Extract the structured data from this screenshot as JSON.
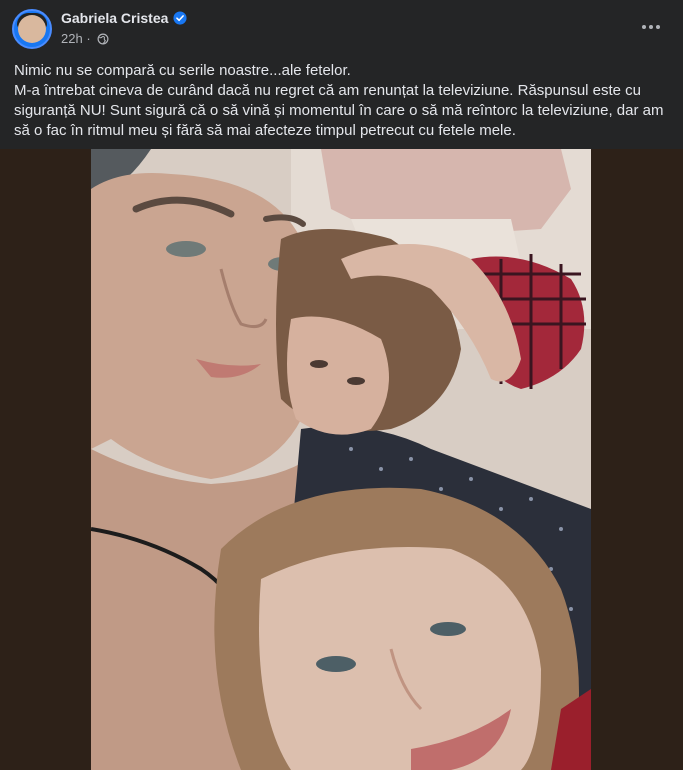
{
  "post": {
    "author": "Gabriela Cristea",
    "time": "22h",
    "privacy_icon": "globe-icon",
    "verified_icon": "verified-badge-icon",
    "more_icon": "more-options-icon",
    "text_lines": [
      "Nimic nu se compară cu serile noastre...ale fetelor.",
      "M-a întrebat cineva de curând dacă nu regret că am renunțat la televiziune. Răspunsul este cu siguranță NU! Sunt sigură că o să vină și momentul în care o să mă reîntorc la televiziune, dar am să o fac în ritmul meu și fără să mai afecteze timpul petrecut cu fetele mele."
    ]
  },
  "colors": {
    "background": "#242526",
    "text": "#e4e6eb",
    "secondary_text": "#b0b3b8",
    "verified": "#1877f2",
    "media_backdrop": "#2d2118"
  }
}
